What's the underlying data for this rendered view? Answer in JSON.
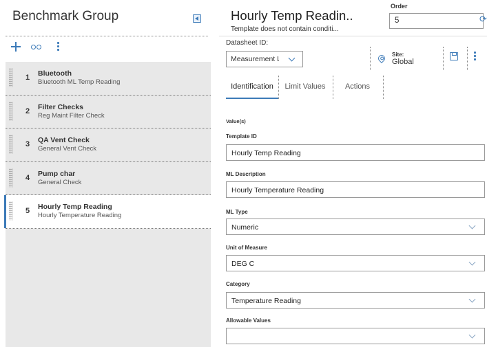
{
  "left_panel": {
    "title": "Benchmark Group",
    "items": [
      {
        "num": "1",
        "title": "Bluetooth",
        "subtitle": "Bluetooth ML Temp Reading"
      },
      {
        "num": "2",
        "title": "Filter Checks",
        "subtitle": "Reg Maint Filter Check"
      },
      {
        "num": "3",
        "title": "QA Vent Check",
        "subtitle": "General Vent Check"
      },
      {
        "num": "4",
        "title": "Pump char",
        "subtitle": "General Check"
      },
      {
        "num": "5",
        "title": "Hourly Temp Reading",
        "subtitle": "Hourly Temperature Reading"
      }
    ],
    "active_index": 4
  },
  "right_panel": {
    "title": "Hourly Temp Readin..",
    "subtitle": "Template does not contain conditi...",
    "order_label": "Order",
    "order_value": "5",
    "datasheet_label": "Datasheet ID:",
    "datasheet_value": "Measurement Lo",
    "site_label": "Site:",
    "site_value": "Global",
    "tabs": [
      "Identification",
      "Limit Values",
      "Actions"
    ],
    "active_tab": "Identification",
    "section_label": "Value(s)",
    "fields": [
      {
        "label": "Template ID",
        "value": "Hourly Temp Reading"
      },
      {
        "label": "ML Description",
        "value": "Hourly Temperature Reading"
      },
      {
        "label": "ML Type",
        "value": "Numeric"
      },
      {
        "label": "Unit of Measure",
        "value": "DEG C"
      },
      {
        "label": "Category",
        "value": "Temperature Reading"
      },
      {
        "label": "Allowable Values",
        "value": ""
      }
    ]
  },
  "colors": {
    "accent": "#3c7ab8",
    "list_bg": "#e8e8e8",
    "selected_bg": "#ffffff"
  }
}
